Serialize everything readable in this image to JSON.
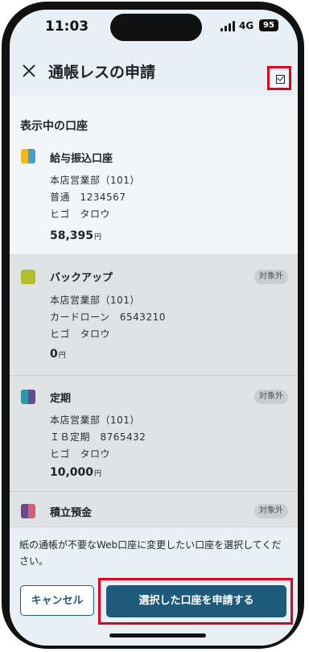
{
  "status_bar": {
    "time": "11:03",
    "network": "4G",
    "battery": "95"
  },
  "header": {
    "title": "通帳レスの申請"
  },
  "section_title": "表示中の口座",
  "accounts": [
    {
      "name": "給与振込口座",
      "branch": "本店営業部（101）",
      "type_number": "普通　1234567",
      "holder": "ヒゴ　タロウ",
      "balance": "58,395",
      "currency": "円",
      "colors": [
        "#f2b91c",
        "#3f9fd6"
      ]
    },
    {
      "name": "バックアップ",
      "branch": "本店営業部（101）",
      "type_number": "カードローン　6543210",
      "holder": "ヒゴ　タロウ",
      "balance": "0",
      "currency": "円",
      "badge": "対象外",
      "colors": [
        "#b3bf2a",
        "#b3bf2a"
      ]
    },
    {
      "name": "定期",
      "branch": "本店営業部（101）",
      "type_number": "ＩＢ定期　8765432",
      "holder": "ヒゴ　タロウ",
      "balance": "10,000",
      "currency": "円",
      "badge": "対象外",
      "colors": [
        "#2a9aa6",
        "#6a4a8c"
      ]
    },
    {
      "name": "積立預金",
      "badge": "対象外",
      "colors": [
        "#6a4a8c",
        "#d0607a"
      ]
    }
  ],
  "footer": {
    "note": "紙の通帳が不要なWeb口座に変更したい口座を選択してください。",
    "cancel_label": "キャンセル",
    "apply_label": "選択した口座を申請する"
  },
  "icons": {
    "close": "close-icon",
    "checkbox": "checkbox-icon"
  },
  "colors": {
    "accent": "#1e5a7a",
    "highlight": "#e0001a"
  }
}
